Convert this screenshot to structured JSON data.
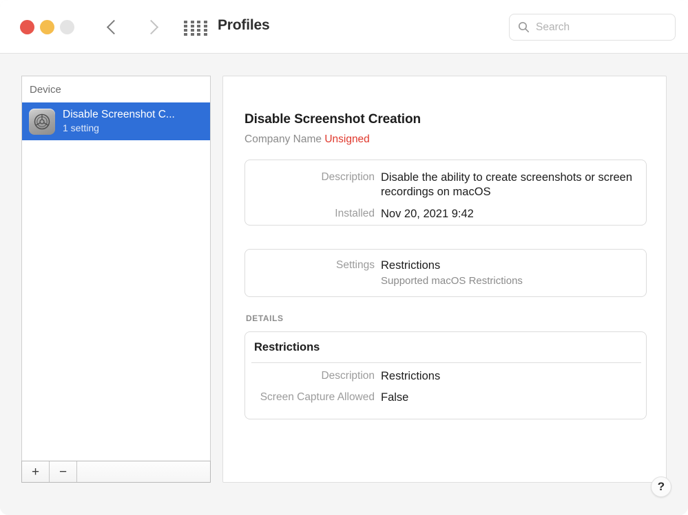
{
  "window": {
    "title": "Profiles",
    "traffic_lights": [
      "close",
      "minimize",
      "zoom"
    ]
  },
  "toolbar": {
    "back_icon": "chevron-left-icon",
    "forward_icon": "chevron-right-icon",
    "grid_icon": "grid-apps-icon",
    "search": {
      "icon": "search-icon",
      "placeholder": "Search",
      "value": ""
    }
  },
  "sidebar": {
    "header": "Device",
    "items": [
      {
        "name": "Disable Screenshot C...",
        "subtitle": "1 setting",
        "icon": "profile-gear-icon",
        "selected": true
      }
    ],
    "footer": {
      "add_label": "+",
      "remove_label": "−"
    }
  },
  "detail": {
    "title": "Disable Screenshot Creation",
    "organization": "Company Name",
    "signed_status": "Unsigned",
    "cards": [
      {
        "id": "description",
        "rows": [
          {
            "label": "Description",
            "value": "Disable the ability to create screenshots or screen recordings on macOS"
          },
          {
            "label": "Installed",
            "value": "Nov 20, 2021 9:42"
          }
        ]
      },
      {
        "id": "settings",
        "rows": [
          {
            "label": "Settings",
            "value": "Restrictions",
            "sub": "Supported macOS Restrictions"
          }
        ]
      }
    ],
    "details_section": {
      "label": "DETAILS",
      "heading": "Restrictions",
      "rows": [
        {
          "label": "Description",
          "value": "Restrictions"
        },
        {
          "label": "Screen Capture Allowed",
          "value": "False"
        }
      ]
    }
  },
  "help": {
    "label": "?"
  },
  "colors": {
    "selection_blue": "#2f6fd8",
    "unsigned_red": "#e0382c",
    "traffic_red": "#e8564c",
    "traffic_yellow": "#f5bd4e",
    "traffic_gray": "#e4e4e4",
    "label_gray": "#9b9b9b"
  }
}
